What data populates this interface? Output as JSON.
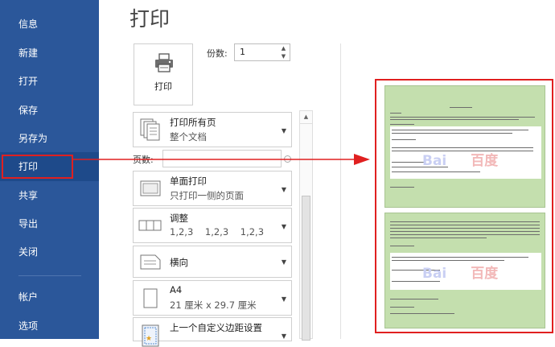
{
  "sidebar": {
    "items": [
      {
        "label": "信息"
      },
      {
        "label": "新建"
      },
      {
        "label": "打开"
      },
      {
        "label": "保存"
      },
      {
        "label": "另存为"
      },
      {
        "label": "打印",
        "active": true
      },
      {
        "label": "共享"
      },
      {
        "label": "导出"
      },
      {
        "label": "关闭"
      },
      {
        "label": "帐户"
      },
      {
        "label": "选项"
      }
    ]
  },
  "main": {
    "title": "打印",
    "print_button_label": "打印",
    "copies_label": "份数:",
    "copies_value": "1",
    "pages_label": "页数:",
    "pages_value": "",
    "settings": [
      {
        "line1": "打印所有页",
        "line2": "整个文档",
        "icon": "pages-icon"
      },
      {
        "line1": "单面打印",
        "line2": "只打印一侧的页面",
        "icon": "single-side-icon"
      },
      {
        "line1": "调整",
        "line2": "1,2,3    1,2,3    1,2,3",
        "icon": "collate-icon"
      },
      {
        "line1": "横向",
        "line2": "",
        "icon": "landscape-icon"
      },
      {
        "line1": "A4",
        "line2": "21 厘米 x 29.7 厘米",
        "icon": "paper-size-icon"
      },
      {
        "line1": "上一个自定义边距设置",
        "line2": "",
        "icon": "margins-icon"
      }
    ]
  },
  "preview": {
    "watermark_latin": "Bai",
    "watermark_chinese": "百度",
    "page_fill_color": "#c4dfae",
    "highlight_color": "#e02020"
  },
  "colors": {
    "sidebar": "#2b579a",
    "sidebar_active": "#1e4a8a"
  }
}
